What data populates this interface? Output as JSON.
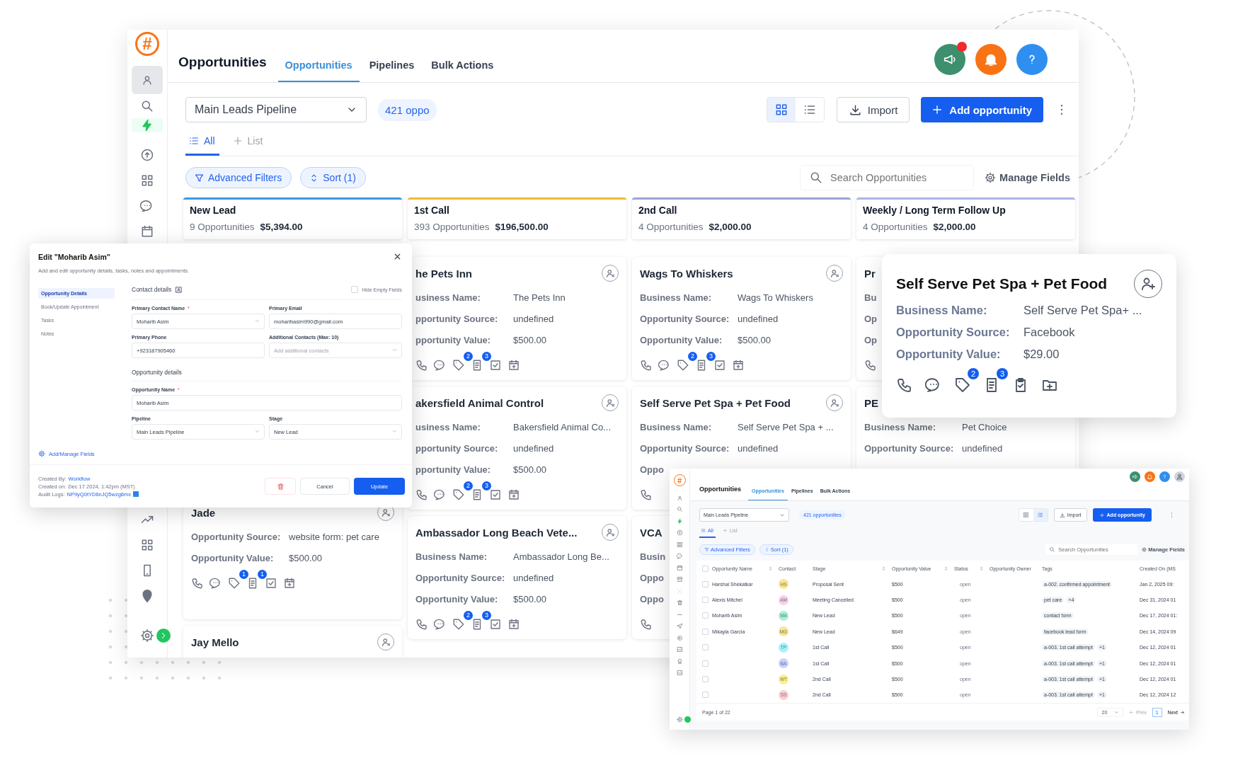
{
  "main": {
    "logo": "#",
    "title": "Opportunities",
    "tabs": [
      {
        "label": "Opportunities",
        "selected": true
      },
      {
        "label": "Pipelines",
        "selected": false
      },
      {
        "label": "Bulk Actions",
        "selected": false
      }
    ],
    "pipeline": "Main Leads Pipeline",
    "count": "421 oppo",
    "views": [
      {
        "kind": "grid",
        "selected": true
      },
      {
        "kind": "list",
        "selected": false
      }
    ],
    "import": "Import",
    "add": "Add opportunity",
    "lists": [
      {
        "label": "All",
        "kind": "list",
        "selected": true
      },
      {
        "label": "List",
        "kind": "new",
        "selected": false
      }
    ],
    "filters": "Advanced Filters",
    "sort": "Sort (1)",
    "search_placeholder": "Search Opportunities",
    "manage_fields": "Manage Fields",
    "columns": [
      {
        "title": "New Lead",
        "count": "9 Opportunities",
        "total": "$5,394.00",
        "color": "#3b9ae1",
        "cards": [
          {
            "kind": "full",
            "title": "Jade",
            "fields": [
              {
                "label": "Opportunity Source:",
                "value": "website form: pet care"
              },
              {
                "label": "Opportunity Value:",
                "value": "$500.00"
              }
            ],
            "assign_icon": true,
            "tag_count": "1",
            "note_count": "1"
          },
          {
            "kind": "none",
            "title": "Jay Mello",
            "assign_icon": true
          }
        ]
      },
      {
        "title": "1st Call",
        "count": "393 Opportunities",
        "total": "$196,500.00",
        "color": "#f5b93a",
        "cards": [
          {
            "kind": "full",
            "title": "he Pets Inn",
            "fields": [
              {
                "label": "usiness Name:",
                "value": "The Pets Inn"
              },
              {
                "label": "pportunity Source:",
                "value": "undefined"
              },
              {
                "label": "pportunity Value:",
                "value": "$500.00"
              }
            ],
            "assign_icon": true,
            "tag_count": "2",
            "note_count": "3"
          },
          {
            "kind": "full",
            "title": "akersfield Animal Control",
            "fields": [
              {
                "label": "usiness Name:",
                "value": "Bakersfield Animal Co..."
              },
              {
                "label": "pportunity Source:",
                "value": "undefined"
              },
              {
                "label": "pportunity Value:",
                "value": "$500.00"
              }
            ],
            "assign_icon": true,
            "tag_count": "2",
            "note_count": "3"
          },
          {
            "kind": "full",
            "title": "Ambassador Long Beach Vete...",
            "fields": [
              {
                "label": "Business Name:",
                "value": "Ambassador Long Be..."
              },
              {
                "label": "Opportunity Source:",
                "value": "undefined"
              },
              {
                "label": "Opportunity Value:",
                "value": "$500.00"
              }
            ],
            "assign_icon": true,
            "tag_count": "2",
            "note_count": "3"
          }
        ]
      },
      {
        "title": "2nd Call",
        "count": "4 Opportunities",
        "total": "$2,000.00",
        "color": "#9ea3cf",
        "cards": [
          {
            "kind": "full",
            "title": "Wags To Whiskers",
            "fields": [
              {
                "label": "Business Name:",
                "value": "Wags To Whiskers"
              },
              {
                "label": "Opportunity Source:",
                "value": "undefined"
              },
              {
                "label": "Opportunity Value:",
                "value": "$500.00"
              }
            ],
            "assign_icon": true,
            "tag_count": "2",
            "note_count": "3"
          },
          {
            "kind": "phone",
            "title": "Self Serve Pet Spa + Pet Food",
            "fields": [
              {
                "label": "Business Name:",
                "value": "Self Serve Pet Spa + ..."
              },
              {
                "label": "Opportunity Source:",
                "value": "undefined"
              },
              {
                "label": "Oppo"
              }
            ],
            "assign_icon": true
          },
          {
            "kind": "phone",
            "title": "VCA",
            "fields": [
              {
                "label": "Busin"
              },
              {
                "label": "Oppo"
              },
              {
                "label": "Oppo"
              }
            ],
            "assign_icon": false
          }
        ]
      },
      {
        "title": "Weekly / Long Term Follow Up",
        "count": "4 Opportunities",
        "total": "$2,000.00",
        "color": "#aab6e6",
        "cards": [
          {
            "kind": "phone",
            "title": "Pr",
            "fields": [
              {
                "label": "Bu"
              },
              {
                "label": "Op"
              },
              {
                "label": "Op"
              }
            ],
            "assign_icon": false
          },
          {
            "kind": "none",
            "title": "PE",
            "fields": [
              {
                "label": "Business Name:",
                "value": "Pet Choice"
              },
              {
                "label": "Opportunity Source:",
                "value": "undefined"
              }
            ],
            "assign_icon": false
          }
        ]
      }
    ]
  },
  "edit_dialog": {
    "title": "Edit \"Moharib Asim\"",
    "subtitle": "Add and edit opportunity details, tasks, notes and appointments.",
    "nav": [
      {
        "label": "Opportunity Details",
        "selected": true
      },
      {
        "label": "Book/Update Appointment",
        "selected": false
      },
      {
        "label": "Tasks",
        "selected": false
      },
      {
        "label": "Notes",
        "selected": false
      }
    ],
    "manage_link": "Add/Manage Fields",
    "contact_heading": "Contact details",
    "hide_empty": {
      "label": "Hide Empty Fields",
      "checked": false
    },
    "contact_fields": [
      {
        "label": "Primary Contact Name",
        "required_mark": "*",
        "kind": "select",
        "value": "Moharib Asim"
      },
      {
        "label": "Primary Email",
        "kind": "text",
        "value": "moharibasim990@gmail.com"
      },
      {
        "label": "Primary Phone",
        "kind": "text",
        "value": "+923187905460"
      },
      {
        "label": "Additional Contacts (Max: 10)",
        "kind": "select",
        "placeholder": "Add additional contacts"
      }
    ],
    "opportunity_heading": "Opportunity details",
    "opportunity_fields": [
      {
        "label": "Opportunity Name",
        "required_mark": "*",
        "kind": "text",
        "wide": true,
        "value": "Moharib Asim"
      },
      {
        "label": "Pipeline",
        "kind": "select",
        "wide": false,
        "value": "Main Leads Pipeline"
      },
      {
        "label": "Stage",
        "kind": "select",
        "wide": false,
        "value": "New Lead"
      }
    ],
    "meta": [
      {
        "label": "Created By:",
        "kind": "link",
        "value": "Workflow"
      },
      {
        "label": "Created on:",
        "kind": "text",
        "value": "Dec 17 2024, 1:42pm (MST)"
      },
      {
        "label": "Audit Logs:",
        "kind": "copy",
        "value": "NP9yQ0tYD6nJQ5wzg6mx"
      }
    ],
    "cancel": "Cancel",
    "update": "Update"
  },
  "card_popup": {
    "title": "Self Serve Pet Spa + Pet Food",
    "fields": [
      {
        "label": "Business Name:",
        "value": "Self Serve Pet Spa+ ..."
      },
      {
        "label": "Opportunity Source:",
        "value": "Facebook"
      },
      {
        "label": "Opportunity Value:",
        "value": "$29.00"
      }
    ],
    "tag_count": "2",
    "note_count": "3"
  },
  "list_window": {
    "logo": "#",
    "title": "Opportunities",
    "tabs": [
      {
        "label": "Opportunities",
        "selected": true
      },
      {
        "label": "Pipelines",
        "selected": false
      },
      {
        "label": "Bulk Actions",
        "selected": false
      }
    ],
    "pipeline": "Main Leads Pipeline",
    "count": "421 opportunities",
    "views": [
      {
        "kind": "grid",
        "selected": false
      },
      {
        "kind": "list",
        "selected": true
      }
    ],
    "import": "Import",
    "add": "Add opportunity",
    "lists": [
      {
        "label": "All",
        "kind": "list",
        "selected": true
      },
      {
        "label": "List",
        "kind": "new",
        "selected": false
      }
    ],
    "filters": "Advanced Filters",
    "sort": "Sort (1)",
    "search_placeholder": "Search Opportunities",
    "manage_fields": "Manage Fields",
    "all_selected": false,
    "columns": [
      {
        "label": "Opportunity Name",
        "sortable": true
      },
      {
        "label": "Contact",
        "sortable": false
      },
      {
        "label": "Stage",
        "sortable": true
      },
      {
        "label": "Opportunity Value",
        "sortable": true
      },
      {
        "label": "Status",
        "sortable": true
      },
      {
        "label": "Opportunity Owner",
        "sortable": false
      },
      {
        "label": "Tags",
        "sortable": false
      },
      {
        "label": "Created On (MS",
        "sortable": false
      }
    ],
    "rows": [
      {
        "selected": false,
        "name": "Harshal Shekatkar",
        "initials": "HS",
        "color": "#fde68a",
        "stage": "Proposal Sent",
        "value": "$500",
        "status": "open",
        "tags": [
          "a-002. confirmed appointment"
        ],
        "created": "Jan 2, 2025 09:"
      },
      {
        "selected": false,
        "name": "Alexis Mitchel",
        "initials": "AM",
        "color": "#fbcfe8",
        "stage": "Meeting Cancelled",
        "value": "$500",
        "status": "open",
        "tags": [
          "pet care",
          "+4"
        ],
        "created": "Dec 31, 2024 01"
      },
      {
        "selected": false,
        "name": "Moharib Asim",
        "initials": "MA",
        "color": "#a7f3d0",
        "stage": "New Lead",
        "value": "$500",
        "status": "open",
        "tags": [
          "contact form"
        ],
        "created": "Dec 17, 2024 01:"
      },
      {
        "selected": false,
        "name": "Mikayla Garcia",
        "initials": "MG",
        "color": "#fde68a",
        "stage": "New Lead",
        "value": "$649",
        "status": "open",
        "tags": [
          "facebook lead form"
        ],
        "created": "Dec 14, 2024 09"
      },
      {
        "selected": false,
        "initials": "TP",
        "color": "#a5f3fc",
        "stage": "1st Call",
        "value": "$500",
        "status": "open",
        "tags": [
          "a-003. 1st call attempt",
          "+1"
        ],
        "created": "Dec 12, 2024 01"
      },
      {
        "selected": false,
        "initials": "BA",
        "color": "#c7d2fe",
        "stage": "1st Call",
        "value": "$500",
        "status": "open",
        "tags": [
          "a-003. 1st call attempt",
          "+1"
        ],
        "created": "Dec 12, 2024 01"
      },
      {
        "selected": false,
        "initials": "WT",
        "color": "#fef08a",
        "stage": "2nd Call",
        "value": "$500",
        "status": "open",
        "tags": [
          "a-003. 1st call attempt",
          "+1"
        ],
        "created": "Dec 12, 2024 01"
      },
      {
        "selected": false,
        "initials": "SS",
        "color": "#fecdd3",
        "stage": "2nd Call",
        "value": "$500",
        "status": "open",
        "tags": [
          "a-003. 1st call attempt",
          "+1"
        ],
        "created": "Dec 12, 2024 12"
      }
    ],
    "page": "Page 1 of 22",
    "page_size": "20",
    "prev": {
      "label": "Prev",
      "disabled": true
    },
    "current_page": "1",
    "next": "Next"
  }
}
